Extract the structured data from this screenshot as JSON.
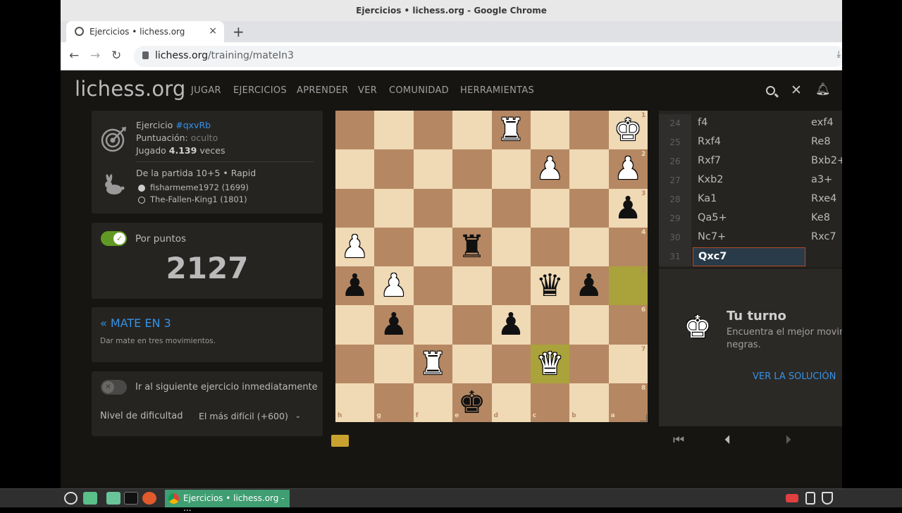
{
  "window": {
    "title": "Ejercicios • lichess.org - Google Chrome"
  },
  "tab": {
    "title": "Ejercicios • lichess.org",
    "close": "×",
    "new": "+"
  },
  "address": {
    "domain": "lichess.org",
    "path": "/training/mateIn3"
  },
  "nav": {
    "back": "←",
    "forward": "→",
    "reload": "↻"
  },
  "site": {
    "logo": "lichess.org",
    "menu": [
      "JUGAR",
      "EJERCICIOS",
      "APRENDER",
      "VER",
      "COMUNIDAD",
      "HERRAMIENTAS"
    ]
  },
  "puzzle": {
    "label": "Ejercicio",
    "id": "#qxvRb",
    "rating_label": "Puntuación:",
    "rating_value": "oculto",
    "played_label": "Jugado",
    "played_count": "4.139",
    "played_suffix": "veces",
    "game_info": "De la partida 10+5 • Rapid",
    "white_player": "fisharmeme1972 (1699)",
    "black_player": "The-Fallen-King1 (1801)"
  },
  "rated": {
    "toggle_label": "Por puntos",
    "toggle_on": true,
    "score": "2127"
  },
  "theme": {
    "title": "« MATE EN 3",
    "description": "Dar mate en tres movimientos."
  },
  "options": {
    "auto_next_label": "Ir al siguiente ejercicio inmediatamente",
    "auto_next_on": false,
    "difficulty_label": "Nivel de dificultad",
    "difficulty_value": "El más difícil (+600)"
  },
  "board": {
    "orientation": "black",
    "files_displayed": [
      "h",
      "g",
      "f",
      "e",
      "d",
      "c",
      "b",
      "a"
    ],
    "ranks_displayed": [
      "1",
      "2",
      "3",
      "4",
      "5",
      "6",
      "7",
      "8"
    ],
    "light_color": "#f0d9b5",
    "dark_color": "#b58863",
    "highlight_color": "#aaa23a",
    "highlights": [
      "a5",
      "c7"
    ],
    "pieces": [
      {
        "sq": "d1",
        "piece": "R"
      },
      {
        "sq": "a1",
        "piece": "K"
      },
      {
        "sq": "c2",
        "piece": "P"
      },
      {
        "sq": "a2",
        "piece": "P"
      },
      {
        "sq": "a3",
        "piece": "p"
      },
      {
        "sq": "h4",
        "piece": "P"
      },
      {
        "sq": "e4",
        "piece": "r"
      },
      {
        "sq": "h5",
        "piece": "p"
      },
      {
        "sq": "g5",
        "piece": "P"
      },
      {
        "sq": "c5",
        "piece": "q"
      },
      {
        "sq": "b5",
        "piece": "p"
      },
      {
        "sq": "g6",
        "piece": "p"
      },
      {
        "sq": "d6",
        "piece": "p"
      },
      {
        "sq": "f7",
        "piece": "R"
      },
      {
        "sq": "c7",
        "piece": "Q"
      },
      {
        "sq": "e8",
        "piece": "k"
      }
    ]
  },
  "moves": [
    {
      "n": "24",
      "white": "f4",
      "black": "exf4"
    },
    {
      "n": "25",
      "white": "Rxf4",
      "black": "Re8"
    },
    {
      "n": "26",
      "white": "Rxf7",
      "black": "Bxb2+"
    },
    {
      "n": "27",
      "white": "Kxb2",
      "black": "a3+"
    },
    {
      "n": "28",
      "white": "Ka1",
      "black": "Rxe4"
    },
    {
      "n": "29",
      "white": "Qa5+",
      "black": "Ke8"
    },
    {
      "n": "30",
      "white": "Nc7+",
      "black": "Rxc7"
    },
    {
      "n": "31",
      "white": "Qxc7",
      "black": ""
    }
  ],
  "turn": {
    "title": "Tu turno",
    "text_line1": "Encuentra el mejor movimi",
    "text_line2": "negras.",
    "solution": "VER LA SOLUCIÓN"
  },
  "controls": {
    "first": "⏮",
    "prev": "⏴",
    "next": "⏵"
  },
  "taskbar": {
    "app_title": "Ejercicios • lichess.org - ..."
  },
  "colors": {
    "accent": "#3692e7",
    "toggle": "#629924",
    "bg": "#161512",
    "panel": "#262421"
  }
}
